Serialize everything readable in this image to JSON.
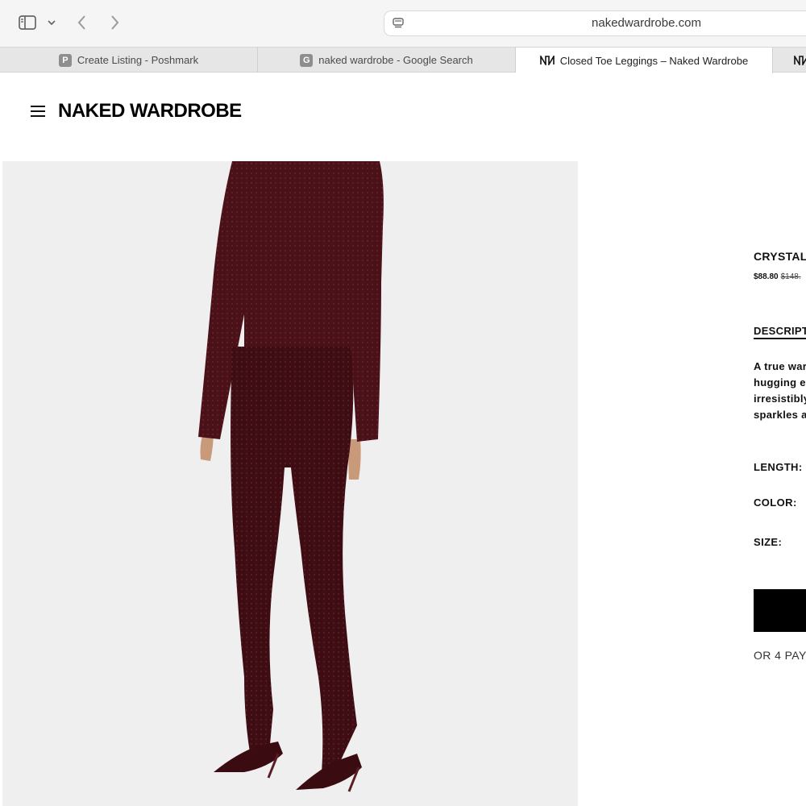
{
  "browser": {
    "url": "nakedwardrobe.com",
    "tabs": [
      {
        "label": "Create Listing - Poshmark",
        "favicon": "P",
        "active": false
      },
      {
        "label": "naked wardrobe - Google Search",
        "favicon": "G",
        "active": false
      },
      {
        "label": "Closed Toe Leggings – Naked Wardrobe",
        "favicon": "NW",
        "active": true
      },
      {
        "label": "",
        "favicon": "NW",
        "active": false
      }
    ]
  },
  "site": {
    "brand": "NAKED WARDROBE",
    "menu_icon": "hamburger-menu-icon"
  },
  "product": {
    "image_alt": "Model wearing burgundy crystal embellished long-sleeve top and closed toe leggings",
    "title": "CRYSTAL",
    "sale_price": "$88.80",
    "original_price": "$148.",
    "description_tab": "DESCRIPT",
    "description_lines": [
      "A true ward",
      "hugging ev",
      "irresistibly",
      "sparkles a"
    ],
    "options": {
      "length_label": "LENGTH:",
      "color_label": "COLOR:",
      "size_label": "SIZE:"
    },
    "payment_line": "OR 4 PAY"
  },
  "colors": {
    "garment": "#4a1118",
    "image_bg": "#efefef",
    "button": "#000000"
  }
}
